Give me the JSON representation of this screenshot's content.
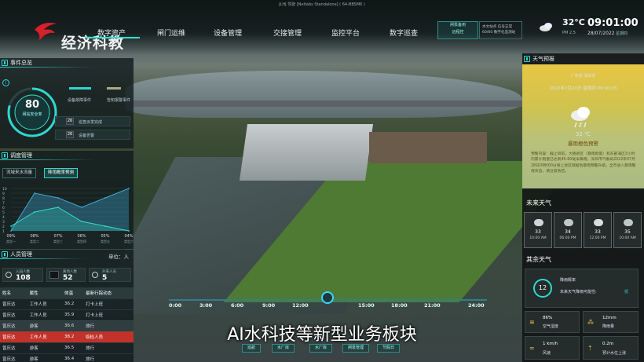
{
  "window_title": "JLHJ 驾驶 [Netlabs Standalone] ( 64-BBSM6 )",
  "brand": {
    "name": "经济科教",
    "accent": "#d8202a"
  },
  "nav": [
    "数字资产",
    "闸门运维",
    "设备管理",
    "交接管理",
    "监控平台",
    "数字巡查"
  ],
  "status_box": {
    "line1": "闸泵备用",
    "line2": "远程控"
  },
  "status_box2": {
    "line1": "水文站点 信号正常",
    "line2": "60/60 数字化监测站"
  },
  "weather_top": {
    "icon": "cloud-icon",
    "temp": "32°C",
    "temp_sub": "PM 2.5",
    "time": "09:01:00",
    "date": "28/07/2022",
    "week": "星期四"
  },
  "events": {
    "title": "事件总览",
    "gauge_value": "80",
    "gauge_label": "闸站安全率",
    "items": [
      {
        "label": "设备故障事件",
        "value": ""
      },
      {
        "label": "告知报警事件",
        "value": ""
      },
      {
        "label": "巡查派发完成",
        "value": "26"
      },
      {
        "label": "设备告警",
        "value": "26"
      }
    ]
  },
  "dispatch": {
    "title": "调度管理",
    "tabs": [
      "流域来水流量",
      "降雨概率预测"
    ],
    "chart_data": {
      "type": "area",
      "series": [
        {
          "name": "",
          "values": [
            1,
            9,
            8,
            6,
            8,
            10
          ]
        },
        {
          "name": "",
          "values": [
            2,
            5,
            6,
            3,
            2,
            1
          ]
        }
      ],
      "categories": [
        "09%",
        "08%",
        "07%",
        "06%",
        "05%",
        "04%"
      ],
      "cat_sub": [
        "类型一",
        "类型二",
        "类型三",
        "类型四",
        "类型五",
        "类型六"
      ],
      "ylabels": [
        "10",
        "9",
        "8",
        "7",
        "6",
        "5",
        "4",
        "3",
        "2",
        "1"
      ],
      "colors": {
        "line1": "#3fa8d8",
        "line2": "#34e0c8"
      }
    }
  },
  "people": {
    "title": "人员管理",
    "unit": "单位：人",
    "stats": [
      {
        "label": "入园人数",
        "value": "108"
      },
      {
        "label": "离场人数",
        "value": "52"
      },
      {
        "label": "外来人员",
        "value": "5"
      }
    ],
    "columns": [
      "姓名",
      "属性",
      "体温",
      "最新行踪动态"
    ],
    "rows": [
      [
        "曾庆达",
        "工作人员",
        "36.2",
        "打卡上班"
      ],
      [
        "曾庆达",
        "工作人员",
        "35.9",
        "打卡上班"
      ],
      [
        "曾庆达",
        "游客",
        "36.6",
        "旅行"
      ],
      [
        "曾庆达",
        "工作人员",
        "38.2",
        "临检人员"
      ],
      [
        "曾庆达",
        "游客",
        "36.5",
        "旅行"
      ],
      [
        "曾庆达",
        "游客",
        "36.4",
        "旅行"
      ]
    ]
  },
  "weather": {
    "title": "天气预报",
    "region": "广东省 深圳市",
    "date": "2022年7月20日 星期四 09:00:03",
    "temp": "32 ℃",
    "alert": "暴雨橙色预警",
    "text": "预警内容：截止目前，大鹏新区（暴雨雨量）和东部海区3小时内累计雨量已达到45-60毫米降雨，深圳市气象局2022年07月28日09时00分将上述区域橙色暴雨预警升级，全市进入暴雨警戒状态，请注意防范。",
    "forecast_title": "未来天气",
    "forecast": [
      {
        "icon": "sun-cloud-icon",
        "temp": "33",
        "time": "10:00 AM"
      },
      {
        "icon": "rain-icon",
        "temp": "34",
        "time": "06:00 PM"
      },
      {
        "icon": "cloud-icon",
        "temp": "33",
        "time": "12:00 PM"
      },
      {
        "icon": "rain-icon",
        "temp": "35",
        "time": "10:00 AM"
      }
    ],
    "other_title": "其余天气",
    "rain": {
      "value": "12",
      "label": "降雨概率",
      "desc": "未来天气降雨可能性:",
      "level": "低"
    },
    "metrics": [
      {
        "icon": "humidity-icon",
        "value": "86%",
        "label": "空气湿度"
      },
      {
        "icon": "rainfall-icon",
        "value": "12mm",
        "label": "降雨量"
      },
      {
        "icon": "wind-icon",
        "value": "1 km/h",
        "label": "风速"
      },
      {
        "icon": "water-level-icon",
        "value": "0.2m",
        "label": "预计水位上涨"
      }
    ]
  },
  "timeline": [
    "0:00",
    "3:00",
    "6:00",
    "9:00",
    "12:00",
    "15:00",
    "18:00",
    "21:00",
    "24:00"
  ],
  "subtitle": "AI水科技等新型业务板块",
  "bottom_buttons": [
    "巡航",
    "水厂库",
    "水厂库",
    "闸泵管理",
    "节假日"
  ]
}
